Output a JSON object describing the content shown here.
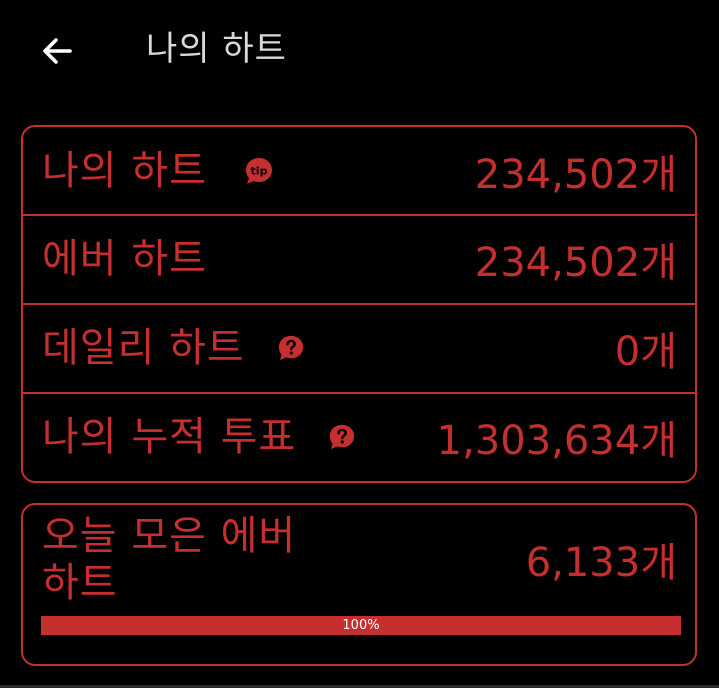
{
  "app_bar": {
    "title": "나의 하트",
    "back_icon": "arrow-left-icon"
  },
  "stats": [
    {
      "label": "나의 하트",
      "value": "234,502개",
      "badge": "tip",
      "badge_icon": "tip-bubble-icon"
    },
    {
      "label": "에버 하트",
      "value": "234,502개"
    },
    {
      "label": "데일리 하트",
      "value": "0개",
      "badge_icon": "question-bubble-icon"
    },
    {
      "label": "나의 누적 투표",
      "value": "1,303,634개",
      "badge_icon": "question-bubble-icon"
    }
  ],
  "today": {
    "label": "오늘 모은 에버 하트",
    "value": "6,133개",
    "progress": 1.0,
    "progress_text": "100%"
  },
  "colors": {
    "accent": "#c62f2f",
    "background": "#000000",
    "title_text": "#d9d9d9"
  }
}
